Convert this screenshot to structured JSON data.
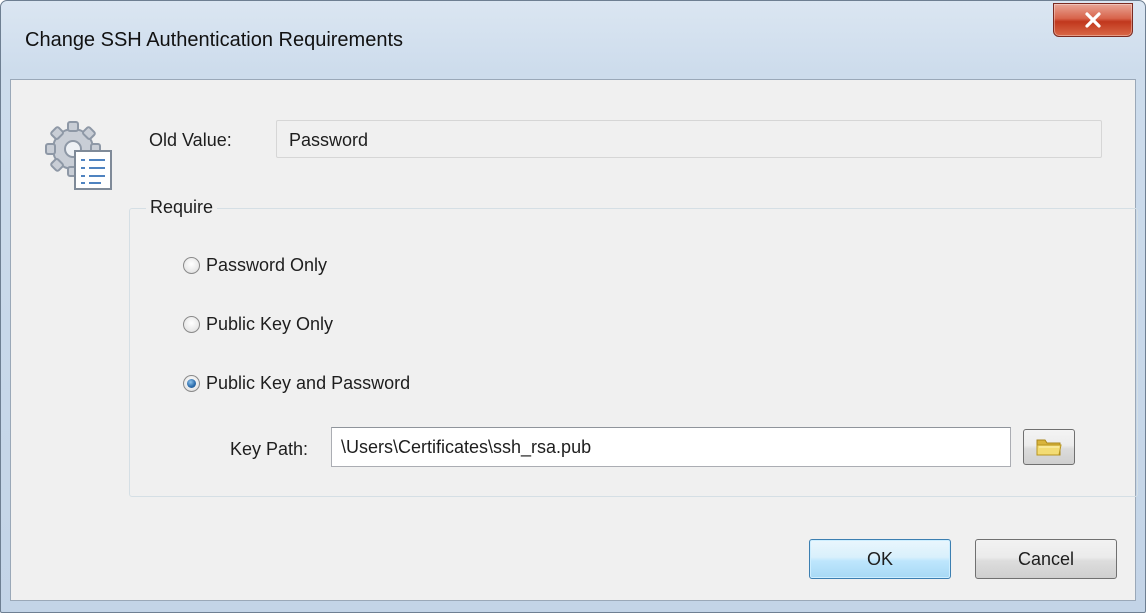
{
  "window": {
    "title": "Change SSH Authentication Requirements"
  },
  "icons": {
    "app": "settings-document-icon",
    "close": "close-icon",
    "browse": "folder-icon"
  },
  "old_value": {
    "label": "Old Value:",
    "value": "Password"
  },
  "require": {
    "legend": "Require",
    "options": [
      {
        "label": "Password Only",
        "checked": false
      },
      {
        "label": "Public Key Only",
        "checked": false
      },
      {
        "label": "Public Key and Password",
        "checked": true
      }
    ],
    "key_path_label": "Key Path:",
    "key_path_value": "\\Users\\Certificates\\ssh_rsa.pub"
  },
  "buttons": {
    "ok": "OK",
    "cancel": "Cancel"
  },
  "colors": {
    "close_button": "#c7412a",
    "ok_button_border": "#3c7fb1",
    "radio_selected": "#2f6fae"
  }
}
